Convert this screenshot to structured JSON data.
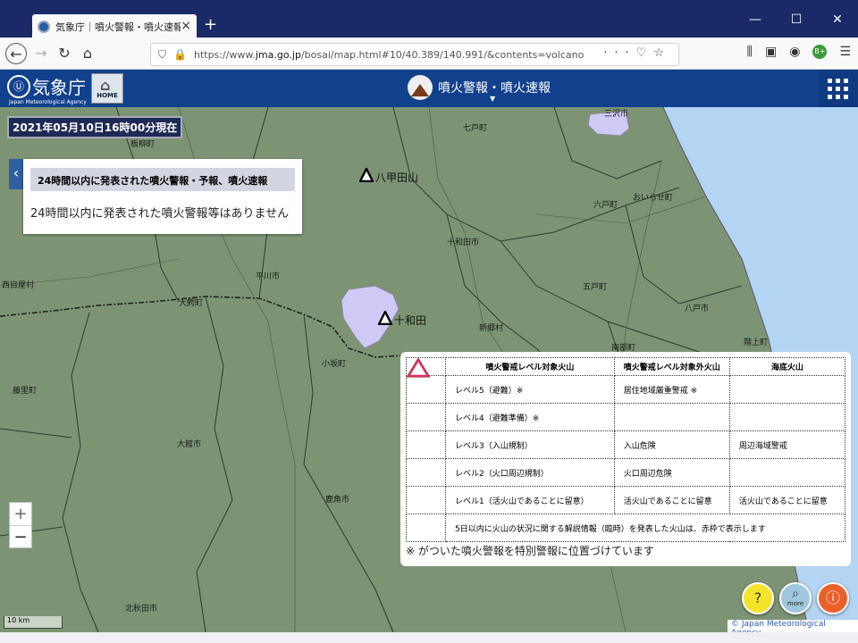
{
  "browser": {
    "tab_title": "気象庁｜噴火警報・噴火速報",
    "new_tab": "+",
    "url_prefix": "https://www.",
    "url_domain": "jma.go.jp",
    "url_suffix": "/bosai/map.html#10/40.389/140.991/&contents=volcano",
    "ext_badge": "B+"
  },
  "site": {
    "logo_jp": "気象庁",
    "logo_en": "Japan Meteorological Agency",
    "home_label": "HOME",
    "page_title": "噴火警報・噴火速報"
  },
  "map": {
    "timestamp": "2021年05月10日16時00分現在",
    "info_header": "24時間以内に発表された噴火警報・予報、噴火速報",
    "info_message": "24時間以内に発表された噴火警報等はありません",
    "volcanoes": [
      {
        "name": "八甲田山"
      },
      {
        "name": "十和田"
      }
    ],
    "places": [
      "三沢市",
      "板柳町",
      "七戸町",
      "おいらせ町",
      "六戸町",
      "十和田市",
      "平川市",
      "五戸町",
      "西目屋村",
      "大鰐町",
      "新郷村",
      "八戸市",
      "南部町",
      "階上町",
      "小坂町",
      "藤里町",
      "大館市",
      "鹿角市",
      "北秋田市"
    ],
    "scale": "10 km",
    "copyright": "© Japan Meteorological Agency",
    "zoom_in": "+",
    "zoom_out": "−"
  },
  "legend": {
    "headers": [
      "噴火警戒レベル対象火山",
      "噴火警戒レベル対象外火山",
      "海底火山"
    ],
    "rows": [
      {
        "color": "#8a3fa8",
        "c1": "レベル5（避難）※",
        "c2": "居住地域厳重警戒 ※",
        "c3": ""
      },
      {
        "color": "#e0401c",
        "c1": "レベル4（避難準備）※",
        "c2": "",
        "c3": ""
      },
      {
        "color": "#f29a2e",
        "c1": "レベル3（入山規制）",
        "c2": "入山危険",
        "c3": "周辺海域警戒"
      },
      {
        "color": "#f0e23a",
        "c1": "レベル2（火口周辺規制）",
        "c2": "火口周辺危険",
        "c3": ""
      },
      {
        "color": "#ffffff",
        "c1": "レベル1（活火山であることに留意）",
        "c2": "活火山であることに留意",
        "c3": "活火山であることに留意"
      }
    ],
    "special_color": "#e0305a",
    "special_text": "5日以内に火山の状況に関する解説情報（臨時）を発表した火山は、赤枠で表示します",
    "note": "※ がついた噴火警報を特別警報に位置づけています"
  },
  "fab_more_label": "more"
}
